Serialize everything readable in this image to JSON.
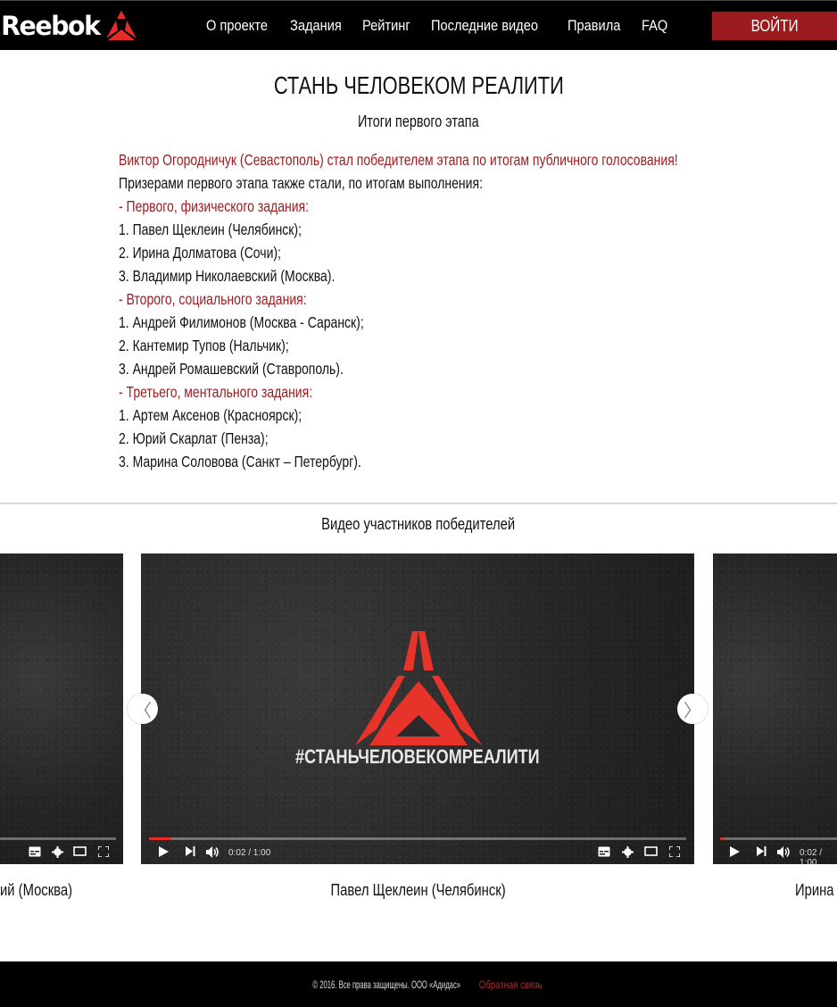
{
  "header": {
    "logo_text": "Reebok",
    "nav": [
      {
        "label": "О проекте"
      },
      {
        "label": "Задания"
      },
      {
        "label": "Рейтинг"
      },
      {
        "label": "Последние видео"
      },
      {
        "label": "Правила"
      },
      {
        "label": "FAQ"
      }
    ],
    "login_label": "ВОЙТИ"
  },
  "main": {
    "title": "СТАНЬ ЧЕЛОВЕКОМ РЕАЛИТИ",
    "subtitle": "Итоги первого этапа",
    "winner_line": "Виктор Огородничук (Севастополь) стал победителем этапа по итогам публичного голосования!",
    "prize_intro": "Призерами первого этапа также стали, по итогам выполнения:",
    "groups": [
      {
        "heading": "- Первого, физического задания:",
        "items": [
          "1. Павел Щеклеин (Челябинск);",
          "2. Ирина Долматова (Сочи);",
          "3. Владимир Николаевский (Москва)."
        ]
      },
      {
        "heading": "- Второго, социального задания:",
        "items": [
          "1. Андрей Филимонов (Москва - Саранск);",
          "2. Кантемир Тупов (Нальчик);",
          "3. Андрей Ромашевский (Ставрополь)."
        ]
      },
      {
        "heading": "- Третьего, ментального задания:",
        "items": [
          "1. Артем Аксенов (Красноярск);",
          "2. Юрий Скарлат (Пенза);",
          "3. Марина Соловова (Санкт – Петербург)."
        ]
      }
    ]
  },
  "videos": {
    "heading": "Видео участников победителей",
    "hashtag": "#СТАНЬЧЕЛОВЕКОМРЕАЛИТИ",
    "time_label": "0:02 / 1:00",
    "progress": 0.033,
    "captions": {
      "left": "ий (Москва)",
      "center": "Павел Щеклеин (Челябинск)",
      "right": "Ирина Д"
    },
    "arrow_left": "〈",
    "arrow_right": "〉"
  },
  "footer": {
    "text": "© 2016. Все права защищены. ООО «Адидас» ",
    "link": "Обратная связь"
  },
  "colors": {
    "accent": "#9b1b1f",
    "brand_red": "#e52d27",
    "header_bg": "#000000"
  }
}
